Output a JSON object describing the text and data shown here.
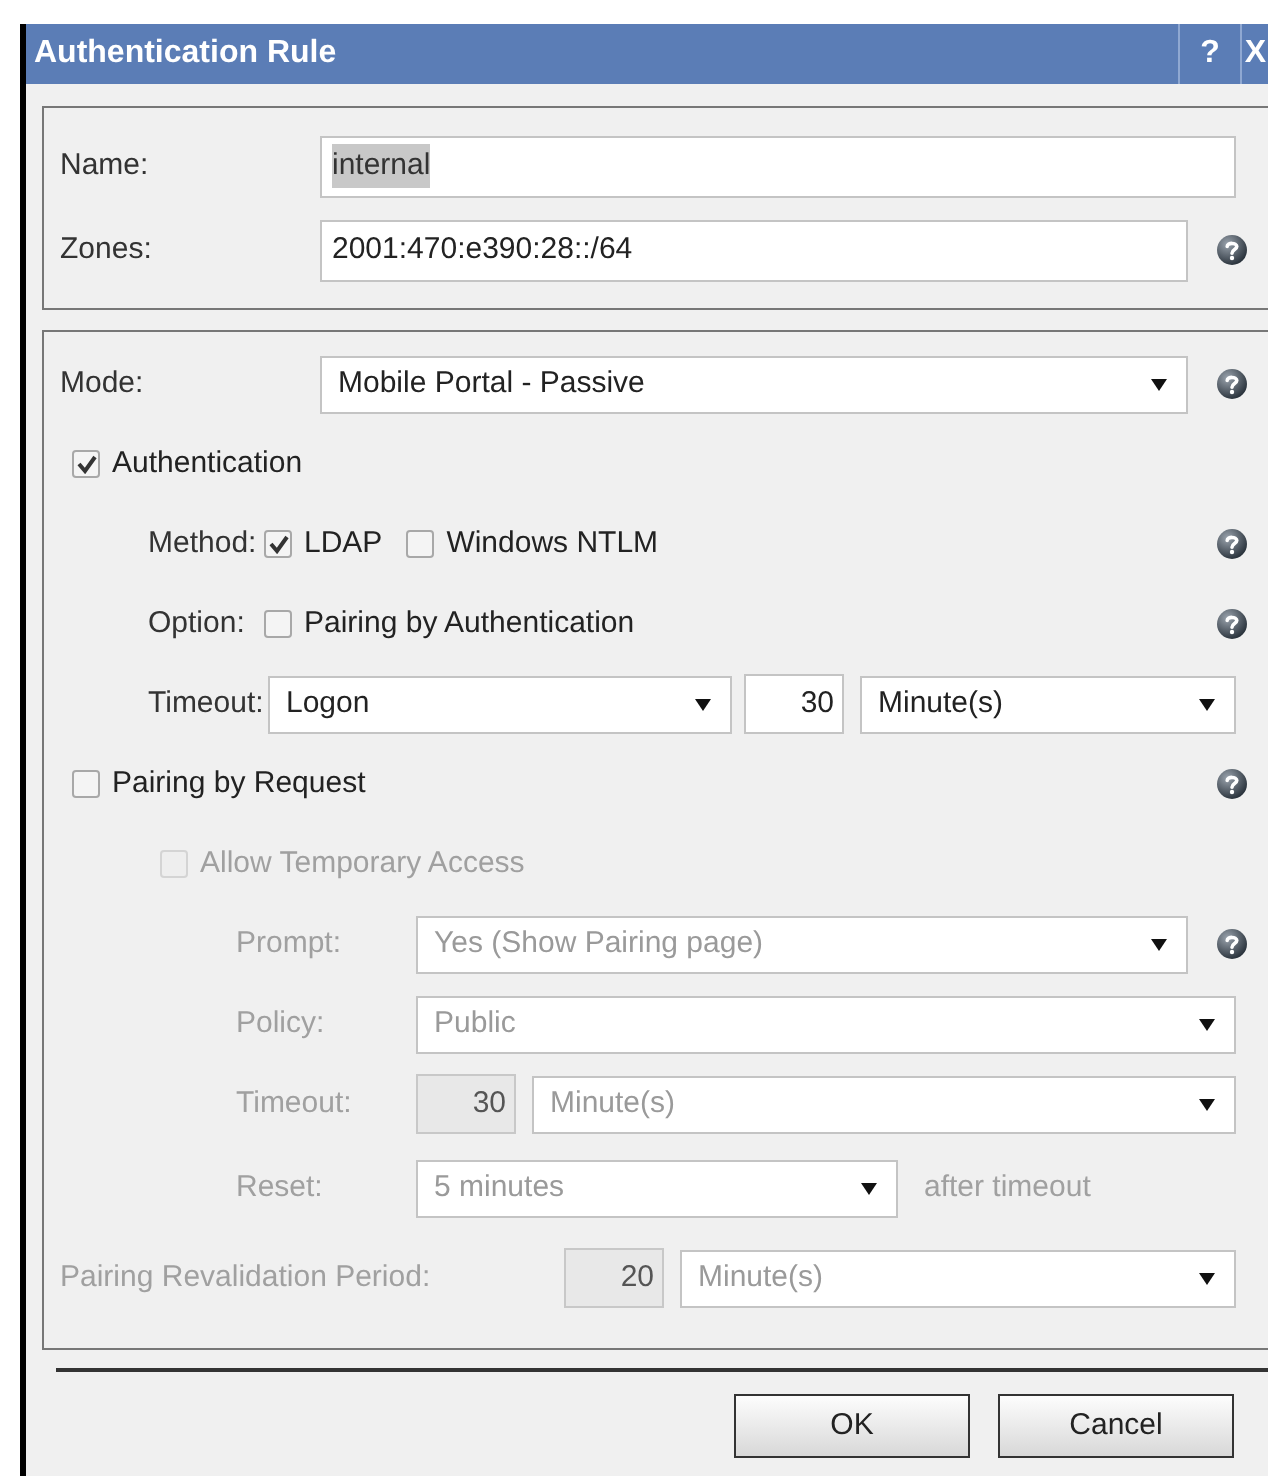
{
  "window": {
    "title": "Authentication Rule",
    "help_button": "?",
    "close_button": "X"
  },
  "identity": [
    {
      "label": "Name:",
      "value": "internal",
      "value_selected": true,
      "help": false
    },
    {
      "label": "Zones:",
      "value": "2001:470:e390:28::/64",
      "value_selected": false,
      "help": true
    }
  ],
  "mode": {
    "label": "Mode:",
    "value": "Mobile Portal - Passive",
    "help": true
  },
  "authentication": {
    "label": "Authentication",
    "checked": true,
    "method": {
      "label": "Method:",
      "options": [
        {
          "label": "LDAP",
          "checked": true
        },
        {
          "label": "Windows NTLM",
          "checked": false
        }
      ],
      "help": true
    },
    "option": {
      "label": "Option:",
      "options": [
        {
          "label": "Pairing by Authentication",
          "checked": false
        }
      ],
      "help": true
    },
    "timeout": {
      "label": "Timeout:",
      "value": "Logon",
      "amount": "30",
      "unit": "Minute(s)"
    }
  },
  "pairing_by_request": {
    "label": "Pairing by Request",
    "checked": false,
    "help": true,
    "allow_temporary_access": {
      "label": "Allow Temporary Access",
      "checked": false,
      "disabled": true
    },
    "prompt": {
      "label": "Prompt:",
      "value": "Yes (Show Pairing page)",
      "help": true,
      "disabled": true
    },
    "policy": {
      "label": "Policy:",
      "value": "Public",
      "help": false,
      "disabled": true
    },
    "timeout": {
      "label": "Timeout:",
      "amount": "30",
      "unit": "Minute(s)",
      "disabled": true
    },
    "reset": {
      "label": "Reset:",
      "value": "5 minutes",
      "suffix": "after timeout",
      "disabled": true
    }
  },
  "revalidation": {
    "label": "Pairing Revalidation Period:",
    "amount": "20",
    "unit": "Minute(s)",
    "disabled": true
  },
  "buttons": [
    {
      "label": "OK"
    },
    {
      "label": "Cancel"
    }
  ]
}
